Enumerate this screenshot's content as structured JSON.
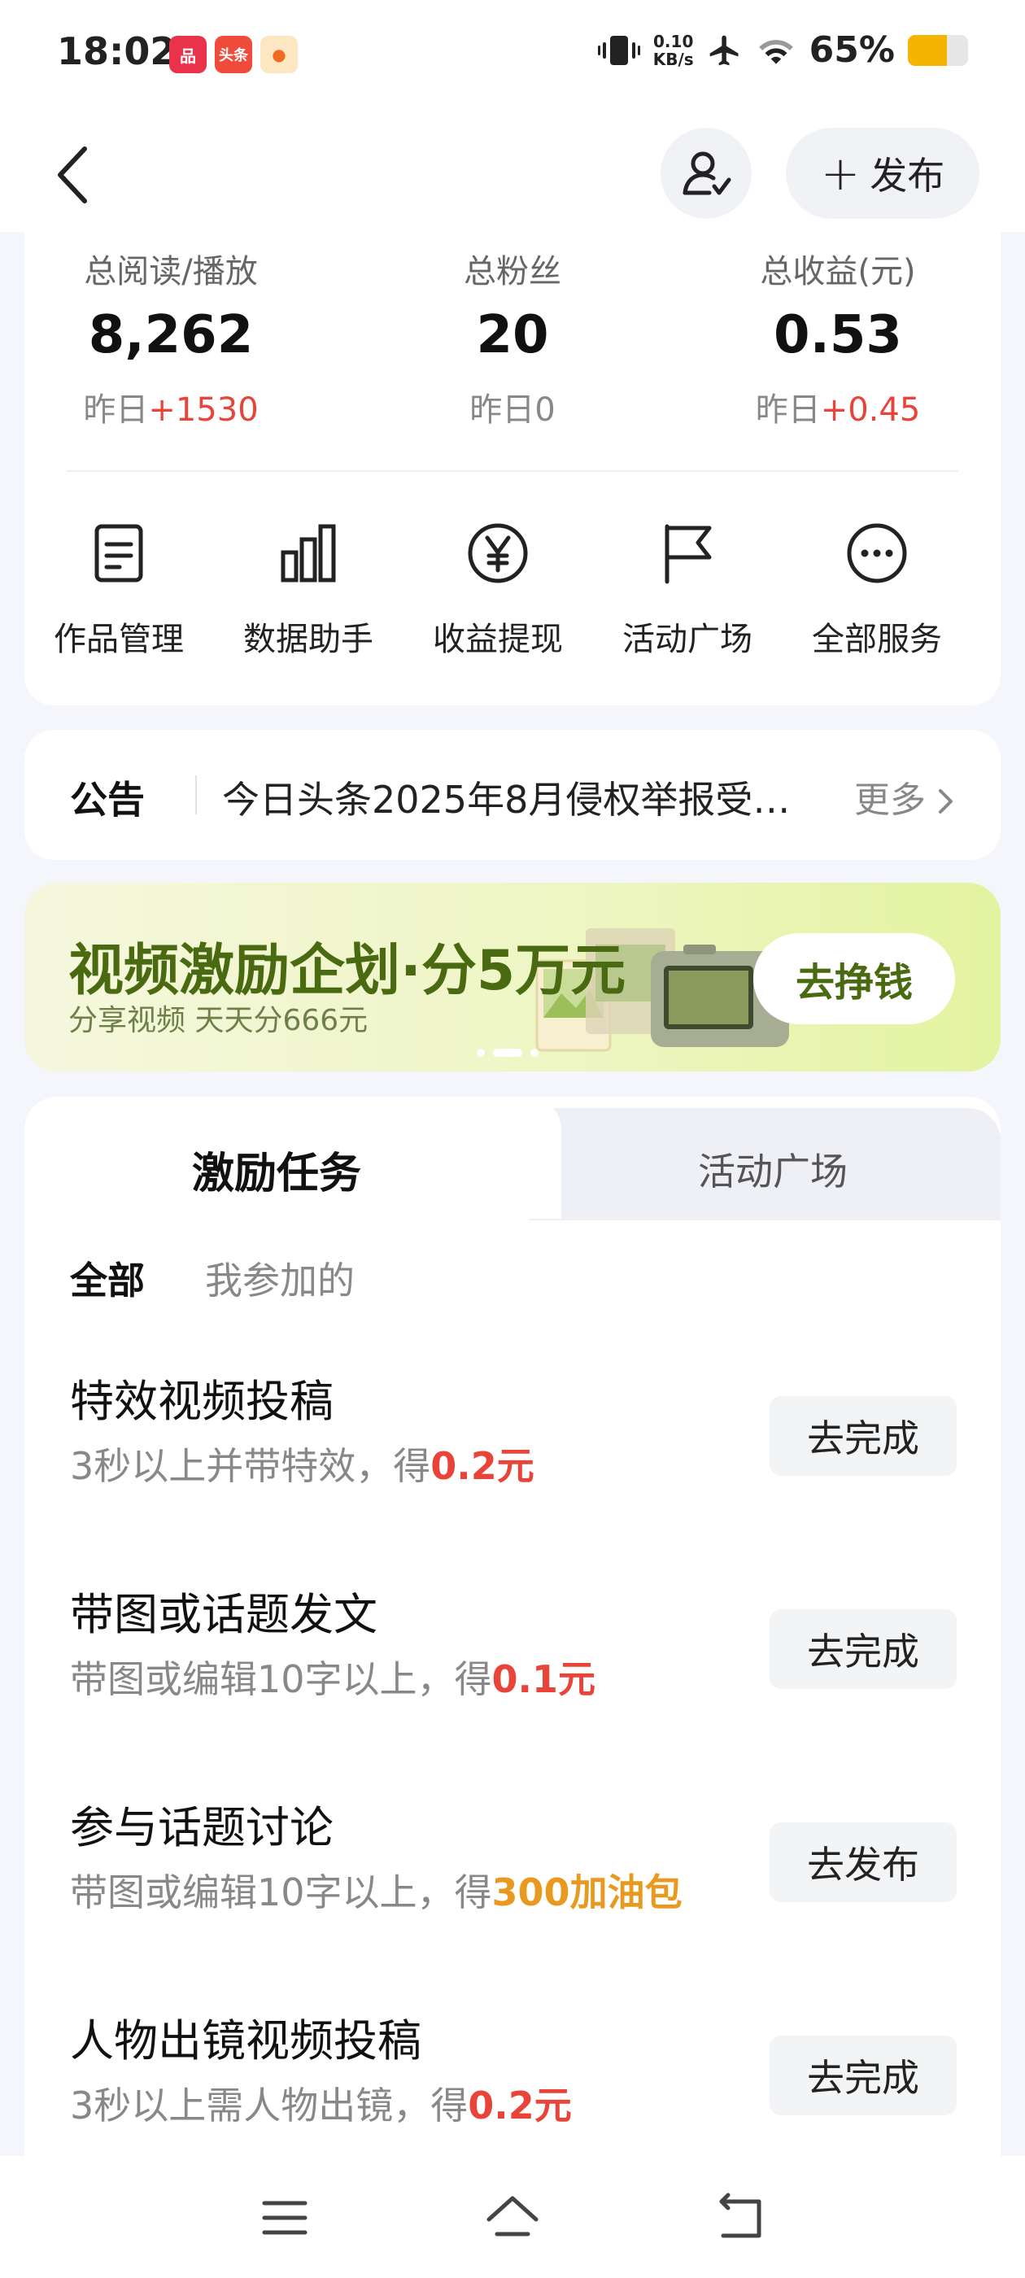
{
  "status_bar": {
    "time": "18:02",
    "apps": [
      {
        "name": "app-badge-1",
        "text": "品",
        "color": "#e8334a"
      },
      {
        "name": "app-badge-2",
        "text": "头条",
        "color": "#f04a3a"
      },
      {
        "name": "app-badge-3",
        "text": "●",
        "color": "#f6a623"
      }
    ],
    "net_speed_value": "0.10",
    "net_speed_unit": "KB/s",
    "battery_percent": "65%",
    "battery_level": 0.65
  },
  "header": {
    "publish_label": "发布"
  },
  "stats": [
    {
      "label": "总阅读/播放",
      "value": "8,262",
      "delta_prefix": "昨日",
      "delta": "+1530"
    },
    {
      "label": "总粉丝",
      "value": "20",
      "delta_prefix": "昨日",
      "delta": "0"
    },
    {
      "label": "总收益(元)",
      "value": "0.53",
      "delta_prefix": "昨日",
      "delta": "+0.45"
    }
  ],
  "services": [
    {
      "label": "作品管理",
      "icon": "document-icon"
    },
    {
      "label": "数据助手",
      "icon": "bar-chart-icon"
    },
    {
      "label": "收益提现",
      "icon": "yen-icon"
    },
    {
      "label": "活动广场",
      "icon": "flag-icon"
    },
    {
      "label": "全部服务",
      "icon": "more-icon"
    }
  ],
  "notice": {
    "tag": "公告",
    "text": "今日头条2025年8月侵权举报受…",
    "more": "更多"
  },
  "banner": {
    "title": "视频激励企划·分5万元",
    "subtitle": "分享视频 天天分666元",
    "button": "去挣钱",
    "slide_count": 3,
    "active_slide": 2
  },
  "tasks": {
    "tabs": [
      {
        "label": "激励任务",
        "active": true
      },
      {
        "label": "活动广场",
        "active": false
      }
    ],
    "filters": [
      {
        "label": "全部",
        "active": true
      },
      {
        "label": "我参加的",
        "active": false
      }
    ],
    "items": [
      {
        "title": "特效视频投稿",
        "desc": "3秒以上并带特效，得",
        "reward": "0.2元",
        "reward_color": "#e8443a",
        "button": "去完成"
      },
      {
        "title": "带图或话题发文",
        "desc": "带图或编辑10字以上，得",
        "reward": "0.1元",
        "reward_color": "#e8443a",
        "button": "去完成"
      },
      {
        "title": "参与话题讨论",
        "desc": "带图或编辑10字以上，得",
        "reward": "300加油包",
        "reward_color": "#e89a20",
        "button": "去发布"
      },
      {
        "title": "人物出镜视频投稿",
        "desc": "3秒以上需人物出镜，得",
        "reward": "0.2元",
        "reward_color": "#e8443a",
        "button": "去完成"
      }
    ]
  },
  "nav": {
    "icons": [
      "menu-icon",
      "home-icon",
      "back-nav-icon"
    ]
  }
}
